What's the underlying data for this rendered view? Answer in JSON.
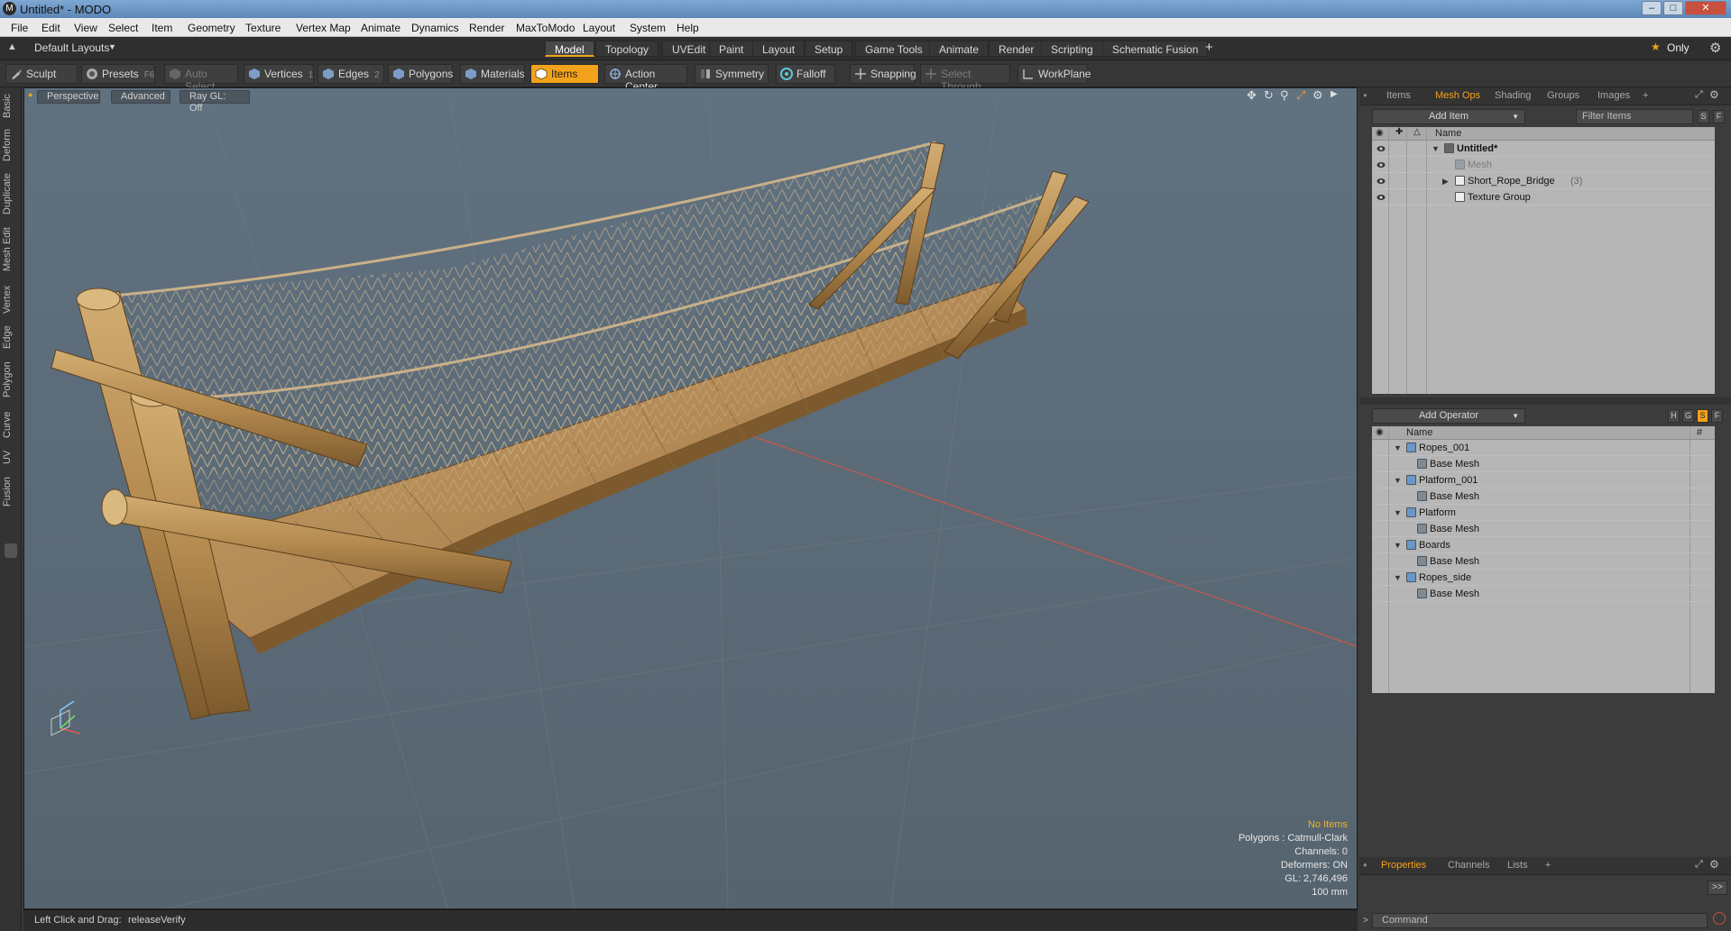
{
  "window": {
    "title": "Untitled* - MODO",
    "app_glyph": "M",
    "minimize": "–",
    "maximize": "□",
    "close": "✕"
  },
  "menu": [
    "File",
    "Edit",
    "View",
    "Select",
    "Item",
    "Geometry",
    "Texture",
    "Vertex Map",
    "Animate",
    "Dynamics",
    "Render",
    "MaxToModo",
    "Layout",
    "System",
    "Help"
  ],
  "layout_bar": {
    "layout_select": "Default Layouts",
    "tabs": [
      "Model",
      "Topology",
      "UVEdit",
      "Paint",
      "Layout",
      "Setup",
      "Game Tools",
      "Animate",
      "Render",
      "Scripting",
      "Schematic Fusion"
    ],
    "active_tab": "Model",
    "add": "+",
    "only_label": "Only",
    "star": "★"
  },
  "toolbar": {
    "sculpt": "Sculpt",
    "presets": "Presets",
    "presets_key": "F6",
    "auto_select": "Auto Select",
    "vertices": "Vertices",
    "vertices_count": "1",
    "edges": "Edges",
    "edges_count": "2",
    "polygons": "Polygons",
    "materials": "Materials",
    "items": "Items",
    "action_center": "Action Center",
    "symmetry": "Symmetry",
    "falloff": "Falloff",
    "snapping": "Snapping",
    "select_through": "Select Through",
    "workplane": "WorkPlane"
  },
  "left_tabs": [
    "Basic",
    "Deform",
    "Duplicate",
    "Mesh Edit",
    "Vertex",
    "Edge",
    "Polygon",
    "Curve",
    "UV",
    "Fusion"
  ],
  "viewport": {
    "view_mode": "Perspective",
    "advanced": "Advanced",
    "raygl": "Ray GL: Off",
    "info": {
      "selection": "No Items",
      "polygons": "Polygons : Catmull-Clark",
      "channels": "Channels: 0",
      "deformers": "Deformers: ON",
      "gl": "GL: 2,746,496",
      "scale": "100 mm"
    }
  },
  "status": {
    "hint": "Left Click and Drag:",
    "action": "releaseVerify"
  },
  "items_panel": {
    "tabs": [
      "Items",
      "Mesh Ops",
      "Shading",
      "Groups",
      "Images",
      "+"
    ],
    "active_tab": "Mesh Ops",
    "add_item": "Add Item",
    "filter": "Filter Items",
    "btn_s": "S",
    "btn_f": "F",
    "col_name": "Name",
    "rows": [
      {
        "label": "Untitled*",
        "count": ""
      },
      {
        "label": "Mesh",
        "count": ""
      },
      {
        "label": "Short_Rope_Bridge",
        "count": "(3)"
      },
      {
        "label": "Texture Group",
        "count": ""
      }
    ]
  },
  "meshops_panel": {
    "add_operator": "Add Operator",
    "btn_h": "H",
    "btn_g": "G",
    "btn_s": "S",
    "btn_f": "F",
    "col_name": "Name",
    "col_hash": "#",
    "rows": [
      "Ropes_001",
      "Base Mesh",
      "Platform_001",
      "Base Mesh",
      "Platform",
      "Base Mesh",
      "Boards",
      "Base Mesh",
      "Ropes_side",
      "Base Mesh"
    ]
  },
  "properties_panel": {
    "tabs": [
      "Properties",
      "Channels",
      "Lists",
      "+"
    ],
    "active_tab": "Properties",
    "expand": ">>",
    "command_placeholder": "Command"
  },
  "colors": {
    "accent": "#f3a21c",
    "viewport_bg": "#5b6b77",
    "wood": "#b48a4f",
    "rope": "#c9b089"
  }
}
